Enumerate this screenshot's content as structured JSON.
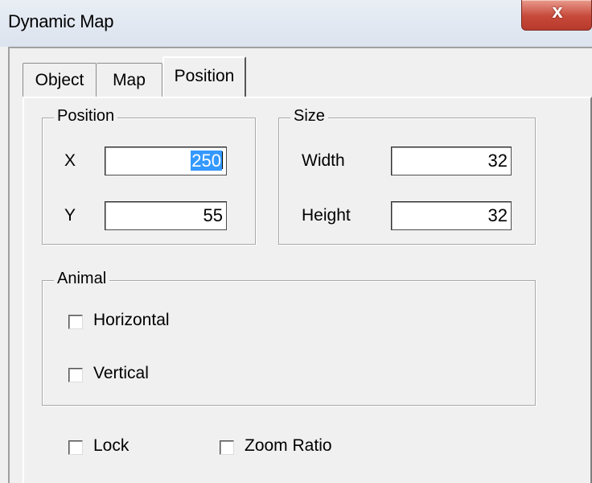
{
  "window": {
    "title": "Dynamic Map",
    "close_glyph": "x"
  },
  "tabs": [
    {
      "label": "Object"
    },
    {
      "label": "Map"
    },
    {
      "label": "Position"
    }
  ],
  "position": {
    "legend": "Position",
    "x_label": "X",
    "x_value": "250",
    "y_label": "Y",
    "y_value": "55"
  },
  "size": {
    "legend": "Size",
    "width_label": "Width",
    "width_value": "32",
    "height_label": "Height",
    "height_value": "32"
  },
  "animal": {
    "legend": "Animal",
    "horizontal_label": "Horizontal",
    "horizontal_checked": false,
    "vertical_label": "Vertical",
    "vertical_checked": false
  },
  "options": {
    "lock_label": "Lock",
    "lock_checked": false,
    "zoom_label": "Zoom Ratio",
    "zoom_checked": false
  },
  "colors": {
    "close_button": "#c6493a",
    "selection": "#3399ff",
    "dialog_bg": "#f0f0f0"
  }
}
